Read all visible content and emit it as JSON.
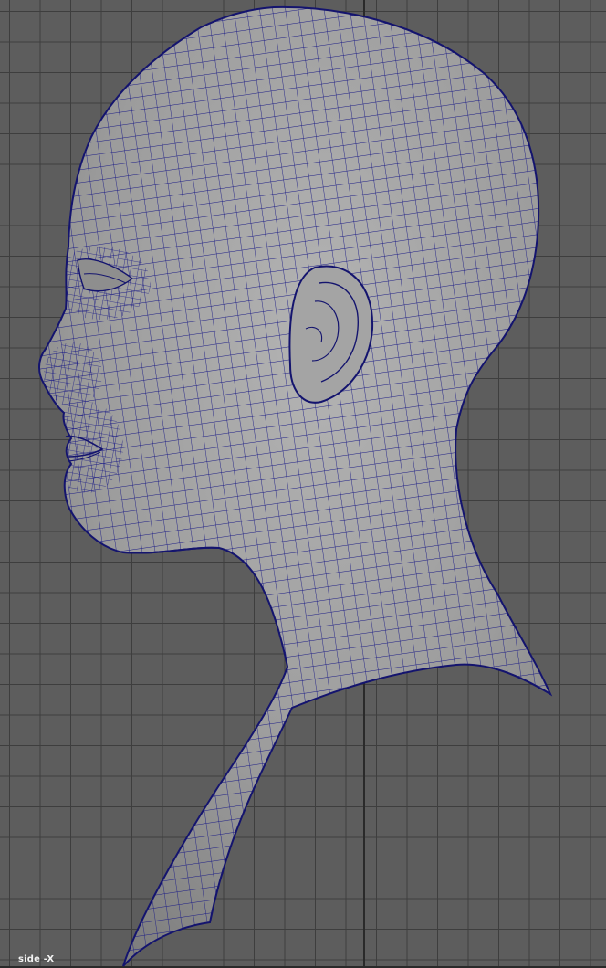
{
  "viewport": {
    "camera_label": "side -X",
    "background_color": "#5d5d5d",
    "grid_color": "#3e3e3e",
    "wire_color": "#1c1c86",
    "surface_color": "#9a9a9a"
  }
}
